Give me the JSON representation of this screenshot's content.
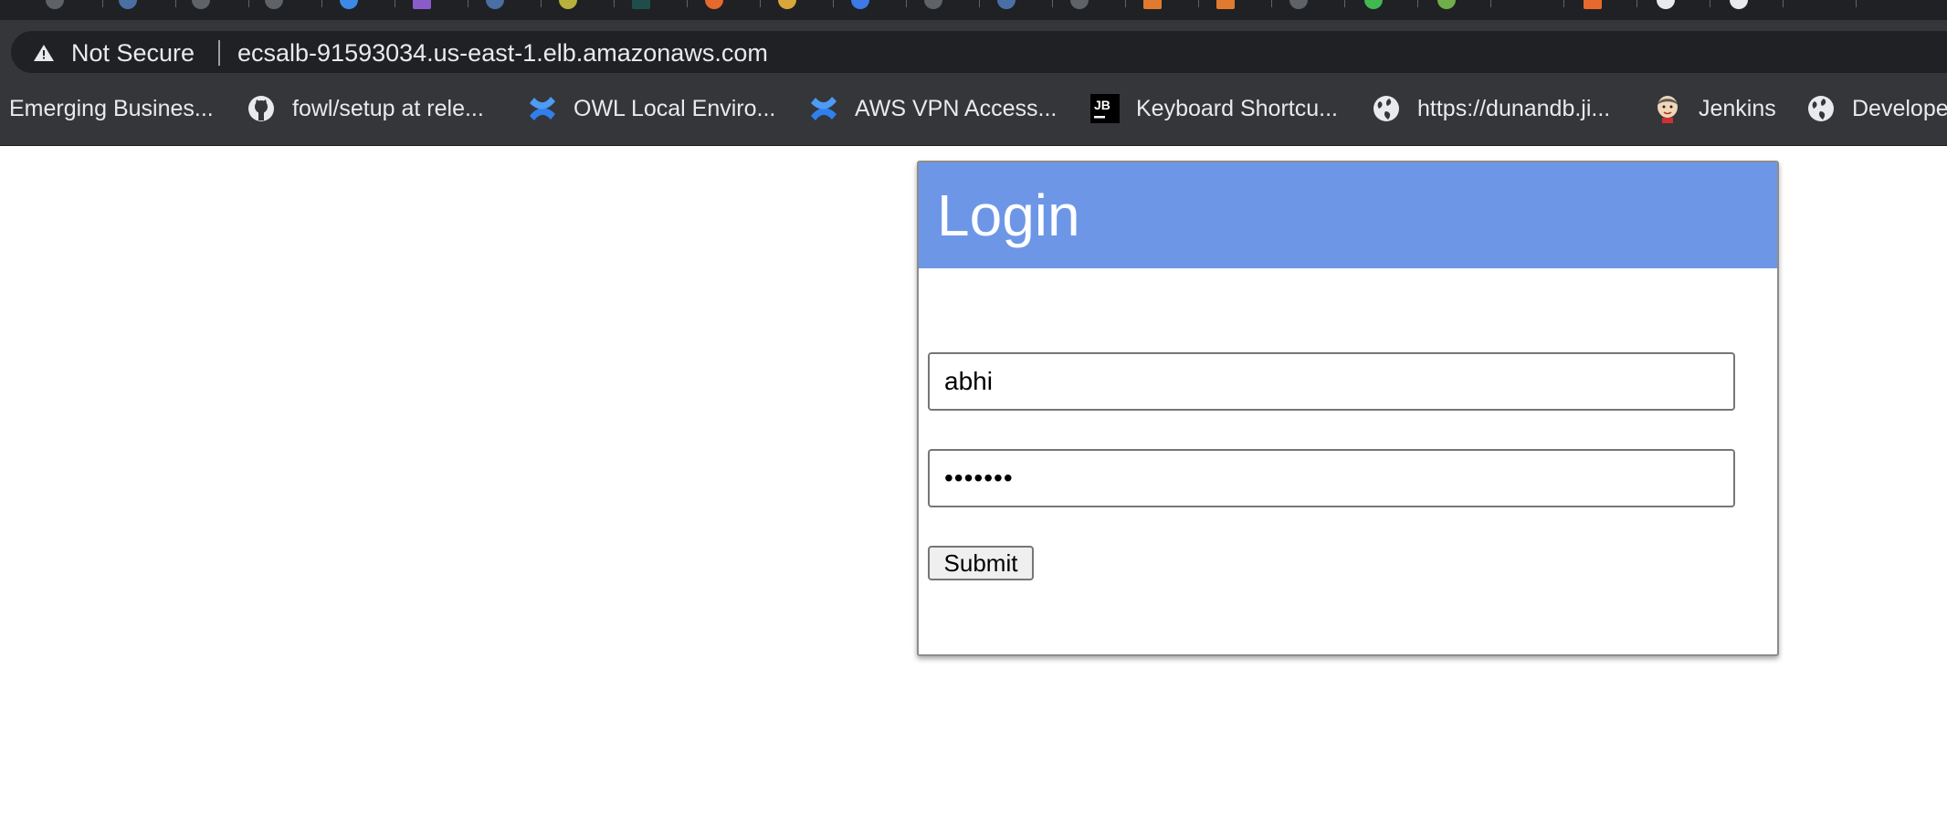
{
  "address_bar": {
    "security_label": "Not Secure",
    "url": "ecsalb-91593034.us-east-1.elb.amazonaws.com"
  },
  "bookmarks": [
    {
      "label": "Emerging Busines...",
      "icon": "none"
    },
    {
      "label": "fowl/setup at rele...",
      "icon": "github-icon"
    },
    {
      "label": "OWL Local Enviro...",
      "icon": "confluence-icon"
    },
    {
      "label": "AWS VPN Access...",
      "icon": "confluence-icon"
    },
    {
      "label": "Keyboard Shortcu...",
      "icon": "jetbrains-icon"
    },
    {
      "label": "https://dunandb.ji...",
      "icon": "globe-icon"
    },
    {
      "label": "Jenkins",
      "icon": "jenkins-icon"
    },
    {
      "label": "Develope",
      "icon": "globe-icon"
    }
  ],
  "login": {
    "title": "Login",
    "username_value": "abhi",
    "password_value": "•••••••",
    "submit_label": "Submit"
  },
  "colors": {
    "header_blue": "#6d97e6",
    "chrome_dark": "#35363a",
    "omnibox_dark": "#202124"
  }
}
